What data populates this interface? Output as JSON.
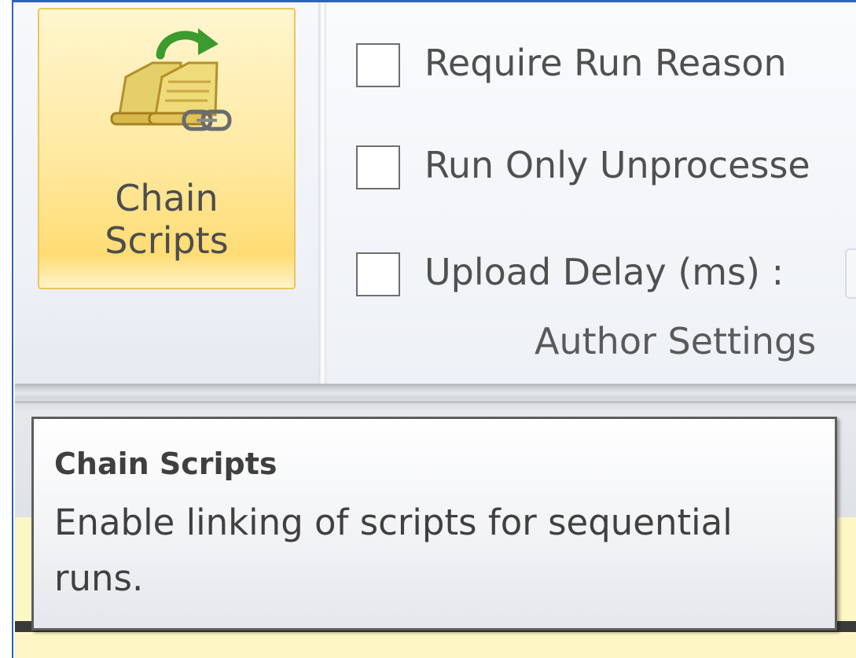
{
  "ribbon": {
    "chain_button": {
      "line1": "Chain",
      "line2": "Scripts"
    },
    "options": [
      {
        "label": "Require Run Reason",
        "checked": false
      },
      {
        "label": "Run Only Unprocesse",
        "checked": false
      },
      {
        "label": "Upload Delay (ms) :",
        "checked": false
      }
    ],
    "group_label": "Author Settings"
  },
  "tooltip": {
    "title": "Chain Scripts",
    "description": "Enable linking of scripts for sequential runs."
  },
  "colors": {
    "window_border": "#2f63b8",
    "button_hover": "#ffe9a0",
    "tooltip_area": "#fdf7c5"
  },
  "icons": {
    "chain_scripts": "chain-scripts-icon"
  }
}
